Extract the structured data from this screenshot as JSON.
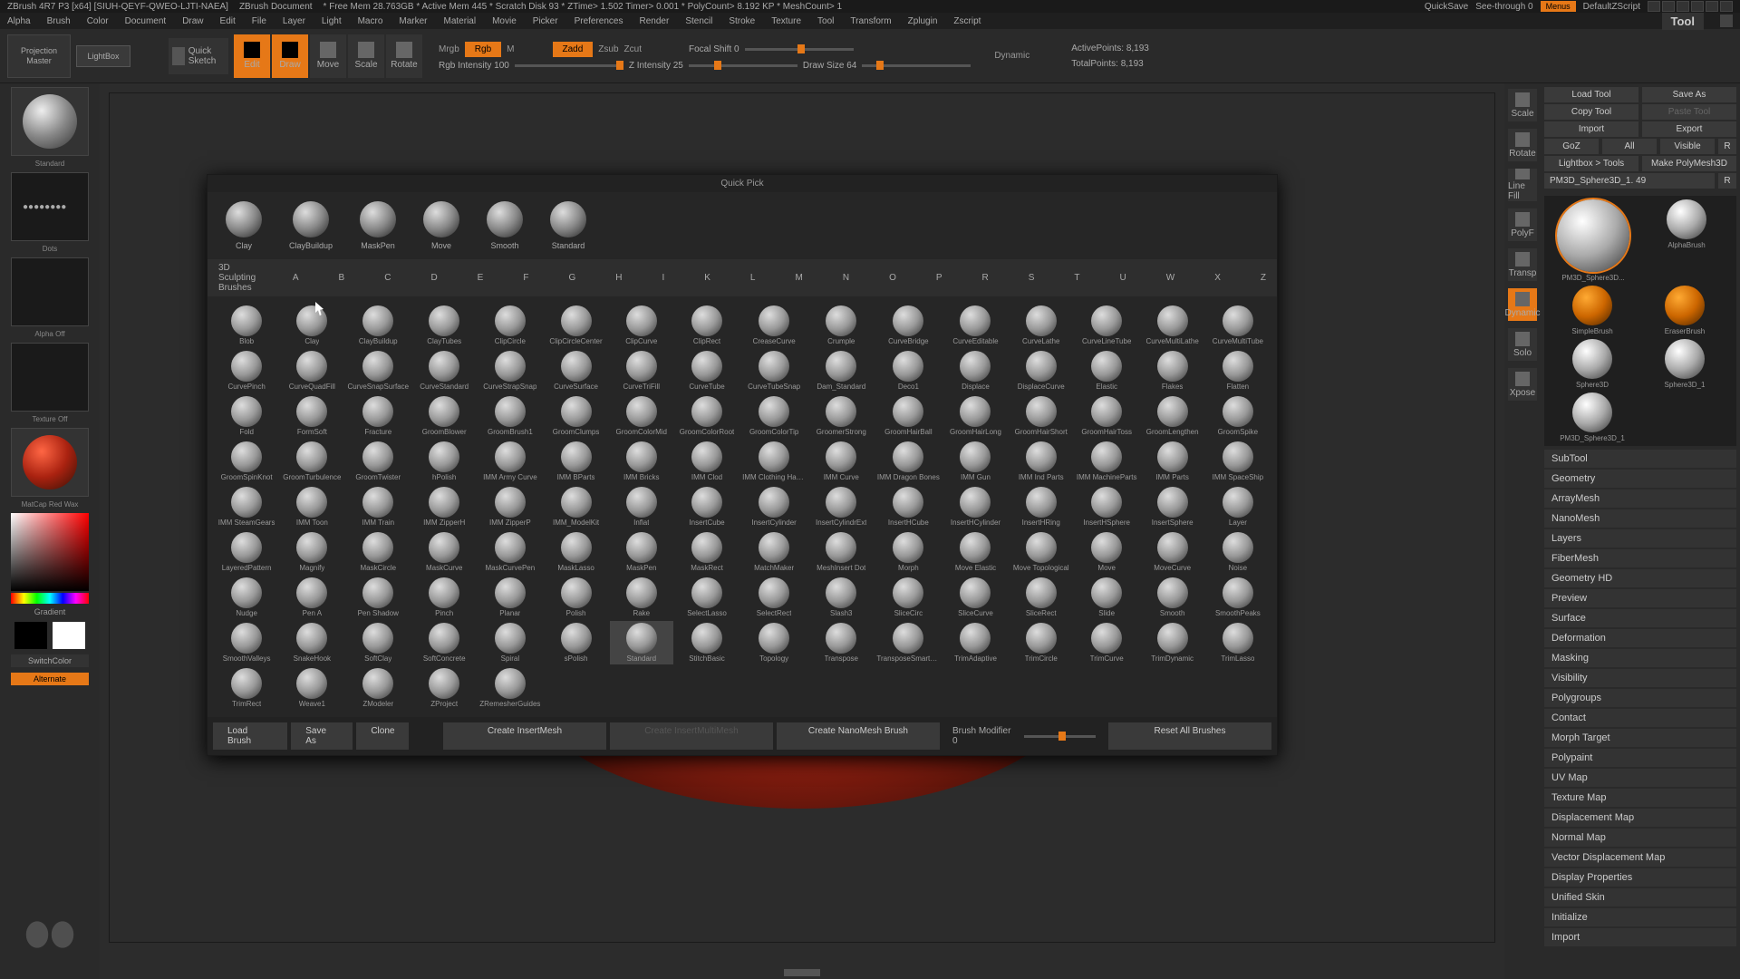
{
  "titlebar": {
    "app": "ZBrush 4R7 P3 [x64] [SIUH-QEYF-QWEO-LJTI-NAEA]",
    "doc": "ZBrush Document",
    "stats": "* Free Mem 28.763GB * Active Mem 445 * Scratch Disk 93 * ZTime> 1.502 Timer> 0.001 * PolyCount> 8.192 KP * MeshCount> 1",
    "quicksave": "QuickSave",
    "seethrough": "See-through  0",
    "menus": "Menus",
    "script": "DefaultZScript"
  },
  "menubar": [
    "Alpha",
    "Brush",
    "Color",
    "Document",
    "Draw",
    "Edit",
    "File",
    "Layer",
    "Light",
    "Macro",
    "Marker",
    "Material",
    "Movie",
    "Picker",
    "Preferences",
    "Render",
    "Stencil",
    "Stroke",
    "Texture",
    "Tool",
    "Transform",
    "Zplugin",
    "Zscript"
  ],
  "menubar_tool": "Tool",
  "toolbar": {
    "projection": "Projection Master",
    "lightbox": "LightBox",
    "quicksketch": "Quick Sketch",
    "modes": [
      "Edit",
      "Draw",
      "Move",
      "Scale",
      "Rotate"
    ],
    "mrgb": "Mrgb",
    "rgb": "Rgb",
    "m": "M",
    "rgb_intensity": "Rgb Intensity 100",
    "zadd": "Zadd",
    "zsub": "Zsub",
    "zcut": "Zcut",
    "z_intensity": "Z Intensity 25",
    "focal_shift": "Focal Shift 0",
    "draw_size": "Draw Size 64",
    "dynamic": "Dynamic",
    "active_pts": "ActivePoints: 8,193",
    "total_pts": "TotalPoints: 8,193"
  },
  "left": {
    "standard": "Standard",
    "dots": "Dots",
    "alpha": "Alpha Off",
    "texture": "Texture Off",
    "matcap": "MatCap Red Wax",
    "gradient": "Gradient",
    "switchcolor": "SwitchColor",
    "alternate": "Alternate"
  },
  "palette": {
    "header": "Quick Pick",
    "quick": [
      "Clay",
      "ClayBuildup",
      "MaskPen",
      "Move",
      "Smooth",
      "Standard"
    ],
    "title": "3D Sculpting Brushes",
    "letters": [
      "A",
      "B",
      "C",
      "D",
      "E",
      "F",
      "G",
      "H",
      "I",
      "K",
      "L",
      "M",
      "N",
      "O",
      "P",
      "R",
      "S",
      "T",
      "U",
      "W",
      "X",
      "Z"
    ],
    "brushes": [
      "Blob",
      "Clay",
      "ClayBuildup",
      "ClayTubes",
      "ClipCircle",
      "ClipCircleCenter",
      "ClipCurve",
      "ClipRect",
      "CreaseCurve",
      "Crumple",
      "CurveBridge",
      "CurveEditable",
      "CurveLathe",
      "CurveLineTube",
      "CurveMultiLathe",
      "CurveMultiTube",
      "CurvePinch",
      "CurveQuadFill",
      "CurveSnapSurface",
      "CurveStandard",
      "CurveStrapSnap",
      "CurveSurface",
      "CurveTriFill",
      "CurveTube",
      "CurveTubeSnap",
      "Dam_Standard",
      "Deco1",
      "Displace",
      "DisplaceCurve",
      "Elastic",
      "Flakes",
      "Flatten",
      "Fold",
      "FormSoft",
      "Fracture",
      "GroomBlower",
      "GroomBrush1",
      "GroomClumps",
      "GroomColorMid",
      "GroomColorRoot",
      "GroomColorTip",
      "GroomerStrong",
      "GroomHairBall",
      "GroomHairLong",
      "GroomHairShort",
      "GroomHairToss",
      "GroomLengthen",
      "GroomSpike",
      "GroomSpinKnot",
      "GroomTurbulence",
      "GroomTwister",
      "hPolish",
      "IMM Army Curve",
      "IMM BParts",
      "IMM Bricks",
      "IMM Clod",
      "IMM Clothing HardW",
      "IMM Curve",
      "IMM Dragon Bones",
      "IMM Gun",
      "IMM Ind Parts",
      "IMM MachineParts",
      "IMM Parts",
      "IMM SpaceShip",
      "IMM SteamGears",
      "IMM Toon",
      "IMM Train",
      "IMM ZipperH",
      "IMM ZipperP",
      "IMM_ModelKit",
      "Inflat",
      "InsertCube",
      "InsertCylinder",
      "InsertCylindrExt",
      "InsertHCube",
      "InsertHCylinder",
      "InsertHRing",
      "InsertHSphere",
      "InsertSphere",
      "Layer",
      "LayeredPattern",
      "Magnify",
      "MaskCircle",
      "MaskCurve",
      "MaskCurvePen",
      "MaskLasso",
      "MaskPen",
      "MaskRect",
      "MatchMaker",
      "MeshInsert Dot",
      "Morph",
      "Move Elastic",
      "Move Topological",
      "Move",
      "MoveCurve",
      "Noise",
      "Nudge",
      "Pen A",
      "Pen Shadow",
      "Pinch",
      "Planar",
      "Polish",
      "Rake",
      "SelectLasso",
      "SelectRect",
      "Slash3",
      "SliceCirc",
      "SliceCurve",
      "SliceRect",
      "Slide",
      "Smooth",
      "SmoothPeaks",
      "SmoothValleys",
      "SnakeHook",
      "SoftClay",
      "SoftConcrete",
      "Spiral",
      "sPolish",
      "Standard",
      "StitchBasic",
      "Topology",
      "Transpose",
      "TransposeSmartMask",
      "TrimAdaptive",
      "TrimCircle",
      "TrimCurve",
      "TrimDynamic",
      "TrimLasso",
      "TrimRect",
      "Weave1",
      "ZModeler",
      "ZProject",
      "ZRemesherGuides"
    ],
    "footer": {
      "load": "Load Brush",
      "saveas": "Save As",
      "clone": "Clone",
      "create_insert": "Create InsertMesh",
      "create_multi": "Create InsertMultiMesh",
      "create_nano": "Create NanoMesh Brush",
      "modifier": "Brush Modifier 0",
      "reset": "Reset All Brushes"
    }
  },
  "right_tools": [
    "Scale",
    "Rotate",
    "Line Fill",
    "PolyF",
    "Transp",
    "Dynamic",
    "Solo",
    "Xpose"
  ],
  "right": {
    "load_tool": "Load Tool",
    "save_as": "Save As",
    "copy": "Copy Tool",
    "paste": "Paste Tool",
    "import": "Import",
    "export": "Export",
    "goz": "GoZ",
    "all": "All",
    "visible": "Visible",
    "r": "R",
    "lightbox_tools": "Lightbox > Tools",
    "make_poly": "Make PolyMesh3D",
    "tool_name": "PM3D_Sphere3D_1. 49",
    "tools": [
      {
        "n": "PM3D_Sphere3D..."
      },
      {
        "n": "AlphaBrush"
      },
      {
        "n": "SimpleBrush"
      },
      {
        "n": "EraserBrush"
      },
      {
        "n": "Sphere3D"
      },
      {
        "n": "Sphere3D_1"
      },
      {
        "n": "PM3D_Sphere3D_1"
      }
    ],
    "sections": [
      "SubTool",
      "Geometry",
      "ArrayMesh",
      "NanoMesh",
      "Layers",
      "FiberMesh",
      "Geometry HD",
      "Preview",
      "Surface",
      "Deformation",
      "Masking",
      "Visibility",
      "Polygroups",
      "Contact",
      "Morph Target",
      "Polypaint",
      "UV Map",
      "Texture Map",
      "Displacement Map",
      "Normal Map",
      "Vector Displacement Map",
      "Display Properties",
      "Unified Skin",
      "Initialize",
      "Import"
    ]
  }
}
